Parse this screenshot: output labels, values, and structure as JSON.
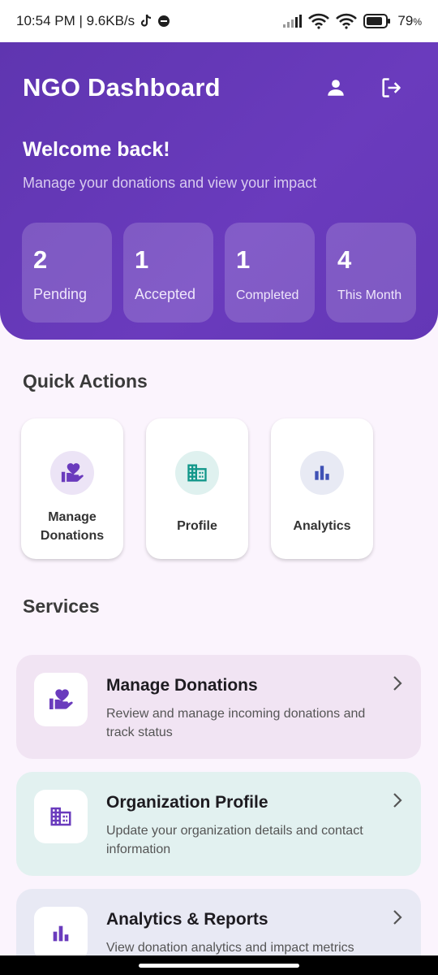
{
  "status_bar": {
    "time_speed": "10:54 PM | 9.6KB/s",
    "battery": "79",
    "battery_unit": "%"
  },
  "header": {
    "title": "NGO Dashboard",
    "welcome_title": "Welcome back!",
    "welcome_subtitle": "Manage your donations and view your impact"
  },
  "stats": [
    {
      "value": "2",
      "label": "Pending"
    },
    {
      "value": "1",
      "label": "Accepted"
    },
    {
      "value": "1",
      "label": "Completed"
    },
    {
      "value": "4",
      "label": "This Month"
    }
  ],
  "quick_actions": {
    "title": "Quick Actions",
    "items": [
      {
        "label": "Manage Donations",
        "icon": "volunteer-activism-icon",
        "icon_bg": "#ece4f6",
        "icon_color": "#6a3bbd"
      },
      {
        "label": "Profile",
        "icon": "business-icon",
        "icon_bg": "#dff1ef",
        "icon_color": "#12978a"
      },
      {
        "label": "Analytics",
        "icon": "bar-chart-icon",
        "icon_bg": "#e8eaf4",
        "icon_color": "#3f51b5"
      }
    ]
  },
  "services": {
    "title": "Services",
    "items": [
      {
        "title": "Manage Donations",
        "description": "Review and manage incoming donations and track status",
        "bg": "#f1e4f3",
        "icon": "volunteer-activism-icon"
      },
      {
        "title": "Organization Profile",
        "description": "Update your organization details and contact information",
        "bg": "#e2f1f0",
        "icon": "business-icon"
      },
      {
        "title": "Analytics & Reports",
        "description": "View donation analytics and impact metrics",
        "bg": "#e8e9f4",
        "icon": "bar-chart-icon"
      }
    ]
  },
  "colors": {
    "primary": "#6a3bbd",
    "teal": "#12978a",
    "indigo": "#3f51b5",
    "background": "#fbf4fd"
  }
}
